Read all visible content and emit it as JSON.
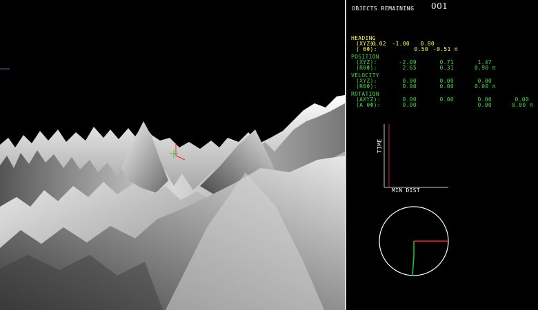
{
  "objects": {
    "label": "OBJECTS REMAINING",
    "count": "001"
  },
  "sections": [
    {
      "title": "HEADING",
      "color": "yellow",
      "rows": [
        {
          "label": "(XYZ):",
          "values": [
            "-0.02",
            "-1.00",
            "0.00"
          ]
        },
        {
          "label": "( θΦ):",
          "values": [
            "",
            "0.50",
            "-0.51 π"
          ]
        }
      ]
    },
    {
      "title": "POSITION",
      "color": "green",
      "rows": [
        {
          "label": "(XYZ):",
          "values": [
            "-2.09",
            "0.71",
            "1.47"
          ]
        },
        {
          "label": "(RθΦ):",
          "values": [
            "2.65",
            "0.31",
            "0.90 π"
          ]
        }
      ]
    },
    {
      "title": "VELOCITY",
      "color": "green",
      "rows": [
        {
          "label": "(XYZ):",
          "values": [
            "0.00",
            "0.00",
            "0.00"
          ]
        },
        {
          "label": "(RθΦ):",
          "values": [
            "0.00",
            "0.00",
            "0.00 π"
          ]
        }
      ]
    },
    {
      "title": "ROTATION",
      "color": "green",
      "rows": [
        {
          "label": "(AXYZ):",
          "values": [
            "0.00",
            "0.00",
            "0.00",
            "0.00"
          ]
        },
        {
          "label": "(A θΦ):",
          "values": [
            "0.00",
            "",
            "0.00",
            "0.00 π"
          ]
        }
      ]
    }
  ],
  "graph": {
    "ylabel": "TIME",
    "xlabel": "MIN DIST"
  },
  "colors": {
    "heading": "#ffff40",
    "data": "#3fdc3f",
    "axis_x": "#ff2020",
    "axis_y": "#20d020",
    "terrain": "#b0b0b0"
  }
}
